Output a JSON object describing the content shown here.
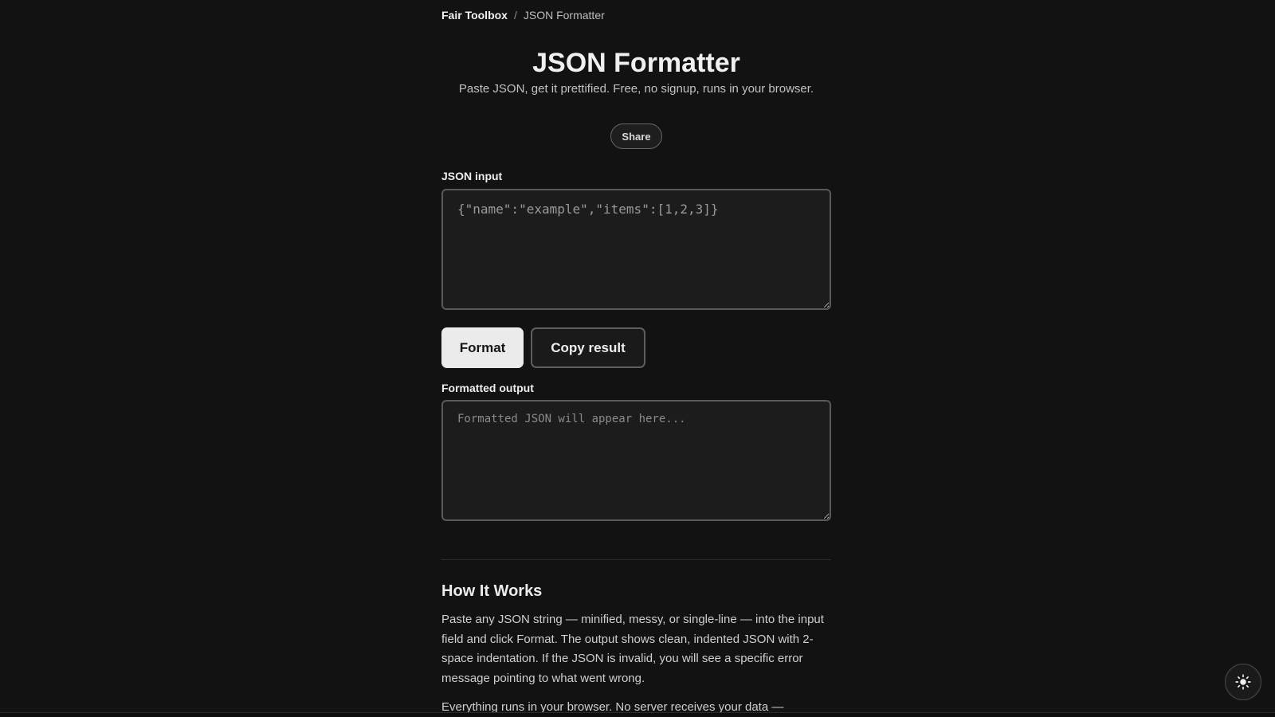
{
  "breadcrumb": {
    "home": "Fair Toolbox",
    "separator": "/",
    "current": "JSON Formatter"
  },
  "header": {
    "title": "JSON Formatter",
    "subtitle": "Paste JSON, get it prettified. Free, no signup, runs in your browser."
  },
  "share": {
    "label": "Share"
  },
  "input": {
    "label": "JSON input",
    "value": "",
    "placeholder": "{\"name\":\"example\",\"items\":[1,2,3]}"
  },
  "actions": {
    "format_label": "Format",
    "copy_label": "Copy result"
  },
  "output": {
    "label": "Formatted output",
    "value": "",
    "placeholder": "Formatted JSON will appear here..."
  },
  "how_it_works": {
    "heading": "How It Works",
    "paragraph1": "Paste any JSON string — minified, messy, or single-line — into the input field and click Format. The output shows clean, indented JSON with 2-space indentation. If the JSON is invalid, you will see a specific error message pointing to what went wrong.",
    "paragraph2": "Everything runs in your browser. No server receives your data —"
  },
  "theme_toggle": {
    "icon": "sun-icon"
  },
  "colors": {
    "background": "#121212",
    "primary_button": "#ebebeb",
    "border": "#595959"
  }
}
